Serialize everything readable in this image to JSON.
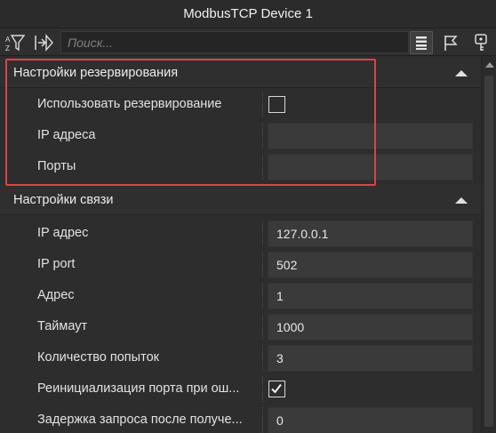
{
  "window": {
    "title": "ModbusTCP Device 1"
  },
  "toolbar": {
    "search_placeholder": "Поиск...",
    "icons": [
      "sort-filter-icon",
      "import-icon",
      "list-view-icon",
      "flag-icon",
      "key-icon"
    ]
  },
  "sections": [
    {
      "title": "Настройки резервирования",
      "rows": [
        {
          "label": "Использовать резервирование",
          "type": "checkbox",
          "checked": false
        },
        {
          "label": "IP адреса",
          "type": "text",
          "value": ""
        },
        {
          "label": "Порты",
          "type": "text",
          "value": ""
        }
      ]
    },
    {
      "title": "Настройки связи",
      "rows": [
        {
          "label": "IP адрес",
          "type": "text",
          "value": "127.0.0.1"
        },
        {
          "label": "IP port",
          "type": "text",
          "value": "502"
        },
        {
          "label": "Адрес",
          "type": "text",
          "value": "1"
        },
        {
          "label": "Таймаут",
          "type": "text",
          "value": "1000"
        },
        {
          "label": "Количество попыток",
          "type": "text",
          "value": "3"
        },
        {
          "label": "Реинициализация порта при ош...",
          "type": "checkbox",
          "checked": true
        },
        {
          "label": "Задержка запроса после получе...",
          "type": "text",
          "value": "0"
        }
      ]
    }
  ],
  "colors": {
    "highlight": "#d9434b",
    "background": "#2d2d2d",
    "field": "#3a3a3a"
  }
}
